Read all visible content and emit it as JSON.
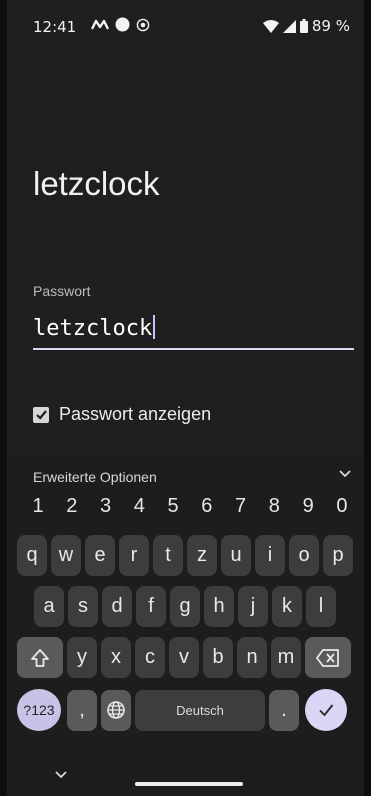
{
  "status_bar": {
    "time": "12:41",
    "battery": "89 %"
  },
  "app": {
    "network_name": "letzclock",
    "password_label": "Passwort",
    "password_value": "letzclock",
    "show_password_label": "Passwort anzeigen",
    "show_password_checked": true
  },
  "keyboard": {
    "advanced_options_label": "Erweiterte Optionen",
    "number_row": [
      "1",
      "2",
      "3",
      "4",
      "5",
      "6",
      "7",
      "8",
      "9",
      "0"
    ],
    "row1": [
      "q",
      "w",
      "e",
      "r",
      "t",
      "z",
      "u",
      "i",
      "o",
      "p"
    ],
    "row2": [
      "a",
      "s",
      "d",
      "f",
      "g",
      "h",
      "j",
      "k",
      "l"
    ],
    "row3": [
      "y",
      "x",
      "c",
      "v",
      "b",
      "n",
      "m"
    ],
    "symbols_key": "?123",
    "comma_key": ",",
    "period_key": ".",
    "space_label": "Deutsch",
    "accent_color": "#d9d6f6"
  }
}
